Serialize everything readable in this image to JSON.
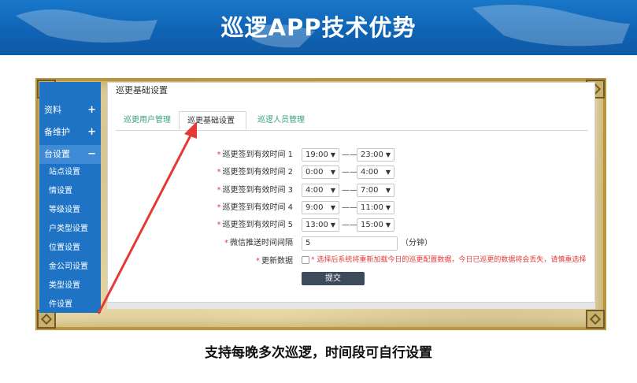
{
  "slide": {
    "title": "巡逻APP技术优势",
    "caption": "支持每晚多次巡逻，时间段可自行设置"
  },
  "sidebar": {
    "items": [
      {
        "label": "资料",
        "toggle": "+"
      },
      {
        "label": "备维护",
        "toggle": "+"
      },
      {
        "label": "台设置",
        "toggle": "−"
      }
    ],
    "subitems": [
      "站点设置",
      "情设置",
      "等级设置",
      "户类型设置",
      "位置设置",
      "金公司设置",
      "类型设置",
      "件设置"
    ]
  },
  "panel": {
    "title": "巡更基础设置",
    "tabs": [
      "巡更用户管理",
      "巡更基础设置",
      "巡逻人员管理"
    ],
    "active_tab": 1
  },
  "form": {
    "rows": [
      {
        "label": "巡更签到有效时间 1",
        "start": "19:00",
        "end": "23:00"
      },
      {
        "label": "巡更签到有效时间 2",
        "start": "0:00",
        "end": "4:00"
      },
      {
        "label": "巡更签到有效时间 3",
        "start": "4:00",
        "end": "7:00"
      },
      {
        "label": "巡更签到有效时间 4",
        "start": "9:00",
        "end": "11:00"
      },
      {
        "label": "巡更签到有效时间 5",
        "start": "13:00",
        "end": "15:00"
      }
    ],
    "dash": "——",
    "wechat_label": "微信推送时间间隔",
    "wechat_value": "5",
    "wechat_unit": "（分钟）",
    "update_label": "更新数据",
    "update_warning": "* 选择后系统将重新加载今日的巡更配置数据，今日已巡更的数据将会丢失，请慎重选择",
    "submit_label": "提交",
    "required_mark": "*",
    "dropdown_mark": "▼"
  },
  "colors": {
    "banner": "#1877c9",
    "sidebar": "#1e73c5",
    "required": "#e23b3b",
    "tab_link": "#37a37c",
    "submit": "#3c4a5c",
    "arrow": "#e53935"
  }
}
